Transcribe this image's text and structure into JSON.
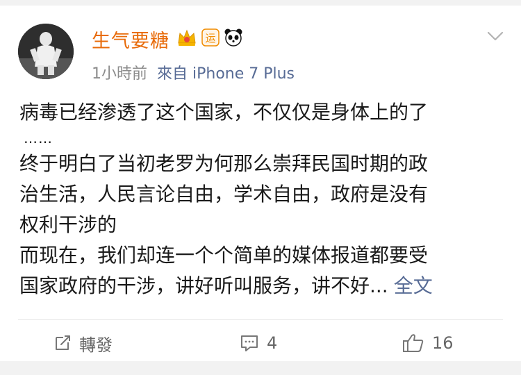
{
  "post": {
    "username": "生气要糖",
    "time": "1小時前",
    "source": "來自 iPhone 7 Plus",
    "content_lines": [
      "病毒已经渗透了这个国家，不仅仅是身体上的了",
      "……",
      "终于明白了当初老罗为何那么崇拜民国时期的政",
      "治生活，人民言论自由，学术自由，政府是没有",
      "权利干涉的",
      "而现在，我们却连一个个简单的媒体报道都要受",
      "国家政府的干涉，讲好听叫服务，讲不好..."
    ],
    "full_text_link": "全文"
  },
  "badges": {
    "crown_icon": "crown-vip-icon",
    "yun_label": "运",
    "panda_icon": "panda-icon"
  },
  "actions": {
    "repost_label": "轉發",
    "comment_count": "4",
    "like_count": "16"
  },
  "colors": {
    "username": "#e86b0a",
    "link": "#576b95",
    "meta": "#8c8c8c"
  }
}
